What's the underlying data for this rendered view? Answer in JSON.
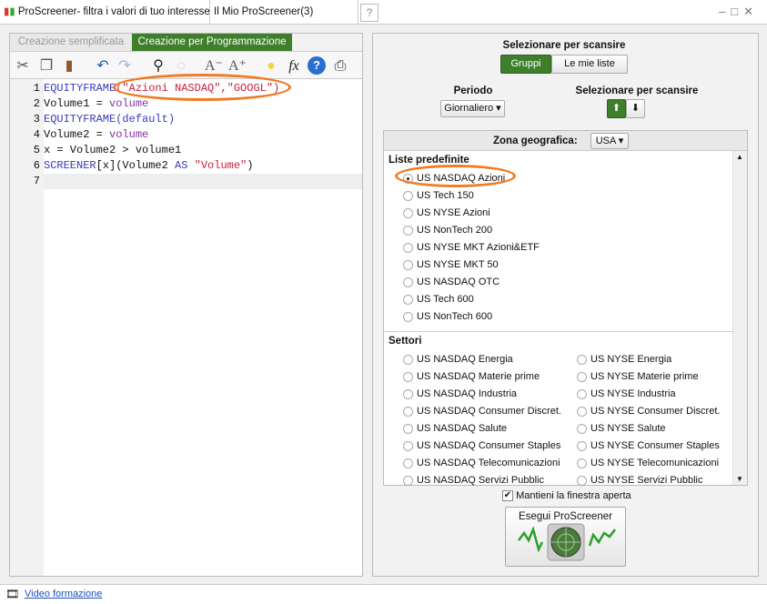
{
  "tabs": {
    "main": "ProScreener- filtra i valori di tuo interesse",
    "mine": "Il Mio ProScreener(3)"
  },
  "editor_tabs": [
    "Creazione semplificata",
    "Creazione per Programmazione"
  ],
  "code": {
    "l1": [
      "EQUITYFRAME",
      "(\"Azioni NASDAQ\",\"GOOGL\")"
    ],
    "l2": [
      "Volume1 = ",
      "volume"
    ],
    "l3": [
      "EQUITYFRAME",
      "(default)"
    ],
    "l4": [
      "Volume2 = ",
      "volume"
    ],
    "l5": [
      "x = Volume2 > volume1"
    ],
    "l6": [
      "SCREENER",
      "[x](Volume2 ",
      "AS",
      " ",
      "\"Volume\"",
      ")"
    ],
    "line_numbers": [
      "1",
      "2",
      "3",
      "4",
      "5",
      "6",
      "7"
    ]
  },
  "right": {
    "scan_label": "Selezionare per scansire",
    "groups": "Gruppi",
    "my_lists": "Le mie liste",
    "period_label": "Periodo",
    "period_value": "Giornaliero ▾",
    "scan_label2": "Selezionare per scansire",
    "zone_label": "Zona geografica:",
    "zone_value": "USA ▾",
    "predef_title": "Liste predefinite",
    "predef": [
      "US NASDAQ Azioni",
      "US Tech 150",
      "US NYSE Azioni",
      "US NonTech 200",
      "US NYSE MKT Azioni&ETF",
      "US NYSE MKT 50",
      "US NASDAQ OTC",
      "US Tech 600",
      "US NonTech 600"
    ],
    "sectors_title": "Settori",
    "sectors_left": [
      "US NASDAQ Energia",
      "US NASDAQ Materie prime",
      "US NASDAQ Industria",
      "US NASDAQ Consumer Discret.",
      "US NASDAQ Salute",
      "US NASDAQ Consumer Staples",
      "US NASDAQ Telecomunicazioni",
      "US NASDAQ Servizi Pubblic"
    ],
    "sectors_right": [
      "US NYSE Energia",
      "US NYSE Materie prime",
      "US NYSE Industria",
      "US NYSE Consumer Discret.",
      "US NYSE Salute",
      "US NYSE Consumer Staples",
      "US NYSE Telecomunicazioni",
      "US NYSE Servizi Pubblic"
    ],
    "keep_open": "Mantieni la finestra aperta",
    "run": "Esegui ProScreener"
  },
  "footer": {
    "video": "Video formazione"
  }
}
